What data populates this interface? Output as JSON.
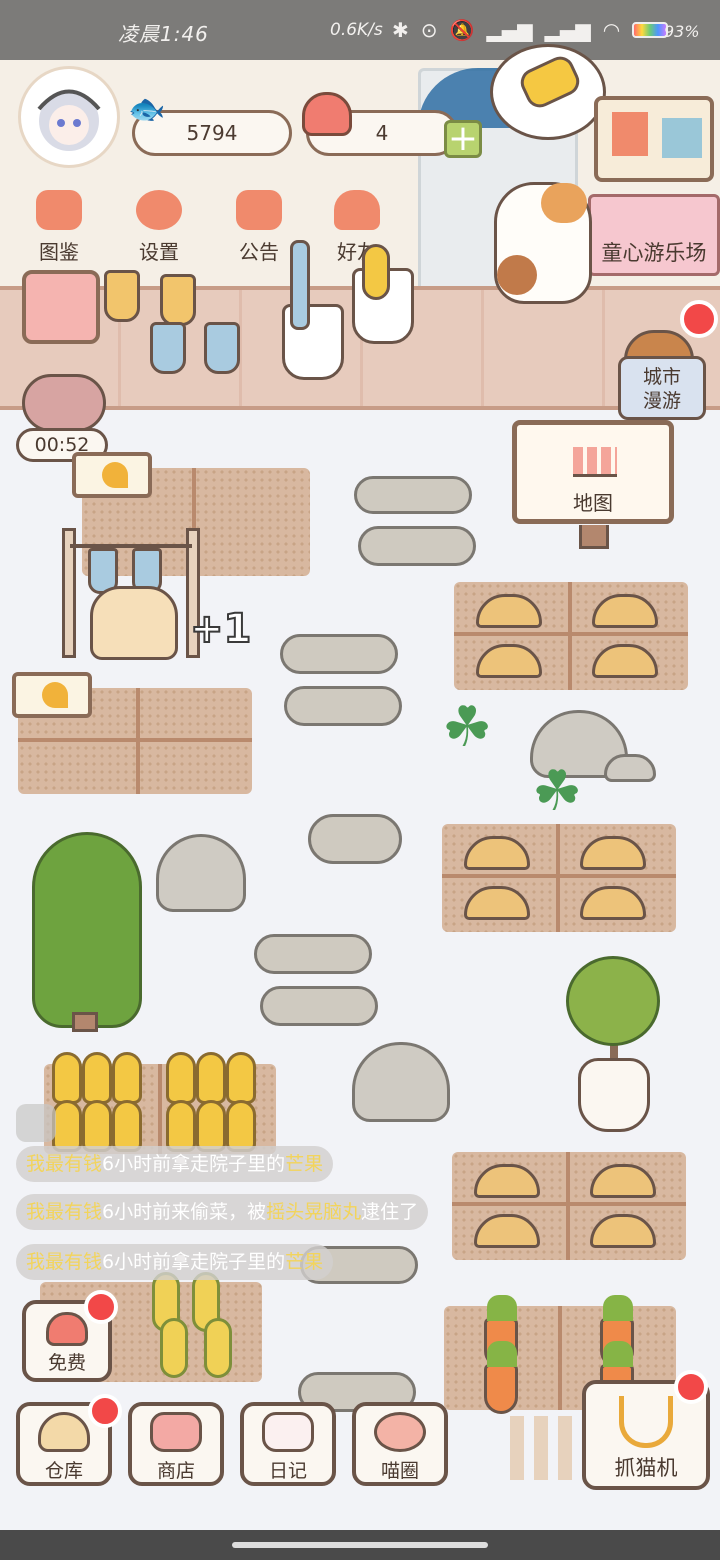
{
  "status_bar": {
    "time": "凌晨1:46",
    "net_speed": "0.6K/s",
    "battery": "93%"
  },
  "currency": {
    "fish": "5794",
    "hearts": "4"
  },
  "top_menu": [
    {
      "label": "图鉴"
    },
    {
      "label": "设置"
    },
    {
      "label": "公告"
    },
    {
      "label": "好友"
    }
  ],
  "banner": {
    "playground": "童心游乐场"
  },
  "city_tour": {
    "line1": "城市",
    "line2": "漫游"
  },
  "timer": "00:52",
  "map_sign": "地图",
  "reward_popup": "+1",
  "feed": [
    {
      "actor": "我最有钱",
      "mid": "6小时前拿走院子里的",
      "item": "芒果",
      "tail": ""
    },
    {
      "actor": "我最有钱",
      "mid": "6小时前来偷菜，被",
      "item": "摇头晃脑丸",
      "tail": "逮住了"
    },
    {
      "actor": "我最有钱",
      "mid": "6小时前拿走院子里的",
      "item": "芒果",
      "tail": ""
    }
  ],
  "free_button": "免费",
  "dock": [
    {
      "label": "仓库"
    },
    {
      "label": "商店"
    },
    {
      "label": "日记"
    },
    {
      "label": "喵圈"
    }
  ],
  "claw_machine": "抓猫机",
  "colors": {
    "badge": "#f24848",
    "accent": "#f08a6c",
    "plus": "#b8d36f"
  },
  "icons": [
    "fish-icon",
    "heart-icon",
    "cat-head-icon",
    "gear-icon",
    "gift-icon",
    "friends-icon",
    "calendar-icon",
    "claw-icon"
  ]
}
